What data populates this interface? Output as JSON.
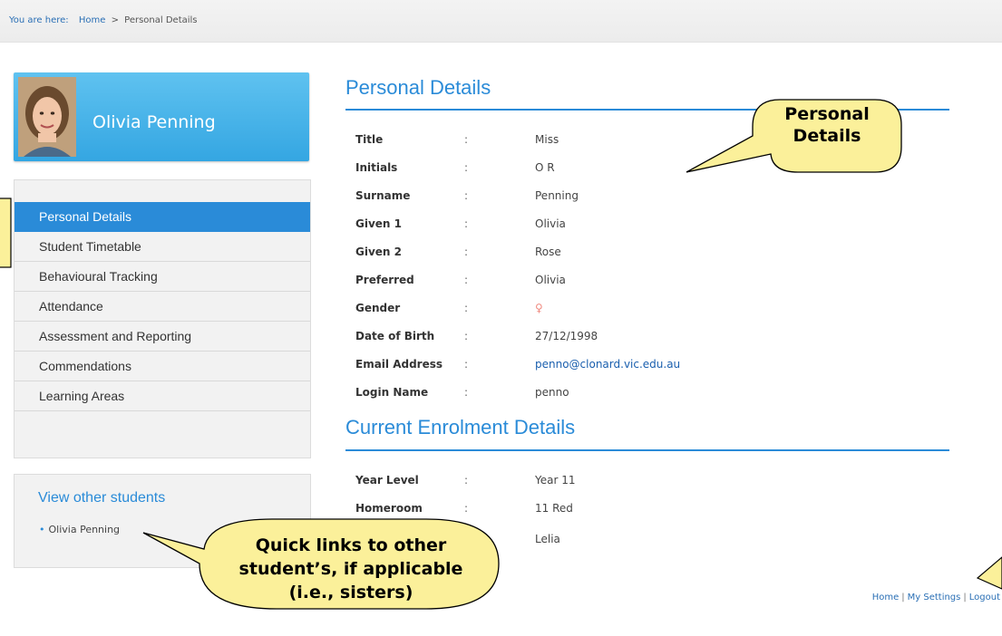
{
  "breadcrumb": {
    "lead": "You are here:",
    "home": "Home",
    "separator": ">",
    "current": "Personal Details"
  },
  "profile": {
    "name": "Olivia Penning",
    "avatar_icon": "student-photo"
  },
  "menu": {
    "items": [
      {
        "label": "Personal Details",
        "active": true
      },
      {
        "label": "Student Timetable"
      },
      {
        "label": "Behavioural Tracking"
      },
      {
        "label": "Attendance"
      },
      {
        "label": "Assessment and Reporting"
      },
      {
        "label": "Commendations"
      },
      {
        "label": "Learning Areas"
      }
    ]
  },
  "other_students": {
    "title": "View other students",
    "items": [
      "Olivia Penning"
    ]
  },
  "personal_details": {
    "title": "Personal Details",
    "separator": ":",
    "fields": [
      {
        "label": "Title",
        "value": "Miss"
      },
      {
        "label": "Initials",
        "value": "O R"
      },
      {
        "label": "Surname",
        "value": "Penning"
      },
      {
        "label": "Given 1",
        "value": "Olivia"
      },
      {
        "label": "Given 2",
        "value": "Rose"
      },
      {
        "label": "Preferred",
        "value": "Olivia"
      },
      {
        "label": "Gender",
        "value": "♀",
        "icon": "female-symbol-icon"
      },
      {
        "label": "Date of Birth",
        "value": "27/12/1998"
      },
      {
        "label": "Email Address",
        "value": "penno@clonard.vic.edu.au"
      },
      {
        "label": "Login Name",
        "value": "penno"
      }
    ]
  },
  "enrolment": {
    "title": "Current Enrolment Details",
    "fields": [
      {
        "label": "Year Level",
        "value": "Year 11"
      },
      {
        "label": "Homeroom",
        "value": "11 Red"
      },
      {
        "label": "",
        "value": "Lelia"
      }
    ]
  },
  "footer": {
    "home": "Home",
    "settings": "My Settings",
    "logout": "Logout",
    "separator": "|"
  },
  "callouts": {
    "personal_details": "Personal Details",
    "quick_links": "Quick links to other student’s, if applicable (i.e., sisters)"
  },
  "colors": {
    "accent": "#2a8bd8",
    "callout_fill": "#fbf09a"
  }
}
